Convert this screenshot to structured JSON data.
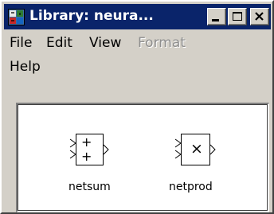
{
  "window": {
    "title": "Library: neura...",
    "title_icon": "simulink-library-icon",
    "controls": {
      "minimize_icon": "minimize-icon",
      "maximize_icon": "maximize-icon",
      "close_icon": "close-icon"
    }
  },
  "menu": {
    "items": [
      {
        "label": "File",
        "enabled": true
      },
      {
        "label": "Edit",
        "enabled": true
      },
      {
        "label": "View",
        "enabled": true
      },
      {
        "label": "Format",
        "enabled": false
      },
      {
        "label": "Help",
        "enabled": true
      }
    ]
  },
  "blocks": [
    {
      "name": "netsum",
      "symbol_top": "+",
      "symbol_bottom": "+"
    },
    {
      "name": "netprod",
      "symbol": "×"
    }
  ],
  "colors": {
    "title_bar": "#0a246a",
    "window_face": "#d4d0c8",
    "canvas": "#ffffff"
  }
}
